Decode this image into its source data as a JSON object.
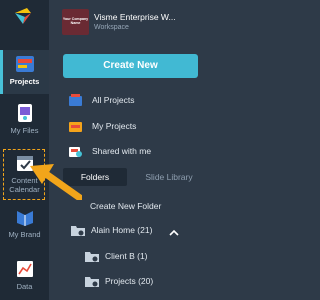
{
  "rail": {
    "items": [
      {
        "label": "Projects"
      },
      {
        "label": "My Files"
      },
      {
        "label": "Content Calendar"
      },
      {
        "label": "My Brand"
      },
      {
        "label": "Data"
      }
    ]
  },
  "workspace": {
    "thumb_text": "Your Company Name",
    "name": "Visme Enterprise W...",
    "subtitle": "Workspace"
  },
  "create_button": "Create New",
  "nav": [
    {
      "label": "All Projects"
    },
    {
      "label": "My Projects"
    },
    {
      "label": "Shared with me"
    }
  ],
  "tabs": [
    {
      "label": "Folders",
      "active": true
    },
    {
      "label": "Slide Library",
      "active": false
    }
  ],
  "tree": {
    "create_folder": "Create New Folder",
    "root": "Alain Home (21)",
    "children": [
      {
        "label": "Client B (1)"
      },
      {
        "label": "Projects (20)"
      }
    ]
  },
  "colors": {
    "accent": "#41b9d3",
    "highlight": "#f2a51a",
    "rail_bg": "#1f2a36",
    "panel_bg": "#2e3a48"
  }
}
